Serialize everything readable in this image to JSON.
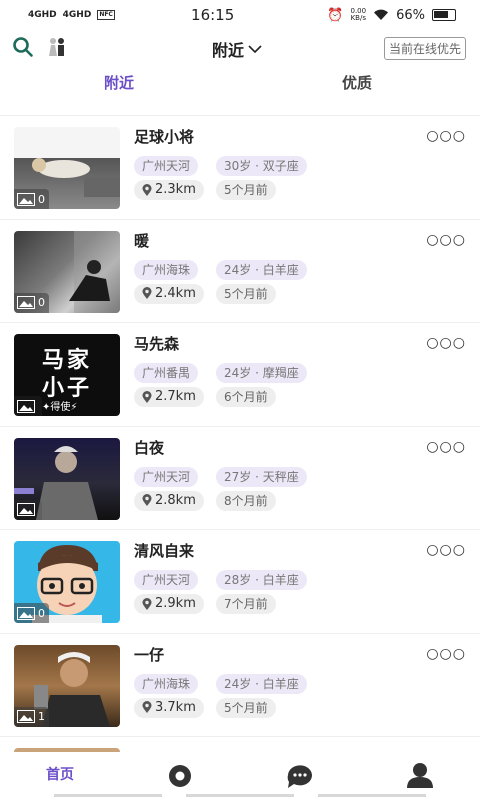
{
  "status_bar": {
    "signal_left": [
      "4GHD",
      "4GHD"
    ],
    "time": "16:15",
    "speed": "0.00",
    "speed_unit": "KB/s",
    "battery": "66%"
  },
  "header": {
    "title": "附近",
    "online_first": "当前在线优先"
  },
  "tabs": [
    "附近",
    "优质"
  ],
  "users": [
    {
      "name": "足球小将",
      "photos": "0",
      "area": "广州天河",
      "age": "30岁 · 双子座",
      "distance": "2.3km",
      "last_active": "5个月前"
    },
    {
      "name": "暖",
      "photos": "0",
      "area": "广州海珠",
      "age": "24岁 · 白羊座",
      "distance": "2.4km",
      "last_active": "5个月前"
    },
    {
      "name": "马先森",
      "photos": "",
      "area": "广州番禺",
      "age": "24岁 · 摩羯座",
      "distance": "2.7km",
      "last_active": "6个月前"
    },
    {
      "name": "白夜",
      "photos": "",
      "area": "广州天河",
      "age": "27岁 · 天秤座",
      "distance": "2.8km",
      "last_active": "8个月前"
    },
    {
      "name": "清风自来",
      "photos": "0",
      "area": "广州天河",
      "age": "28岁 · 白羊座",
      "distance": "2.9km",
      "last_active": "7个月前"
    },
    {
      "name": "一仔",
      "photos": "1",
      "area": "广州海珠",
      "age": "24岁 · 白羊座",
      "distance": "3.7km",
      "last_active": "5个月前"
    }
  ],
  "photo3_text": [
    "马家",
    "小子",
    "✦得使⚡"
  ],
  "bottom_nav": {
    "home": "首页"
  },
  "colors": {
    "accent": "#6c4fc8",
    "tag_bg": "#ece8f7"
  }
}
